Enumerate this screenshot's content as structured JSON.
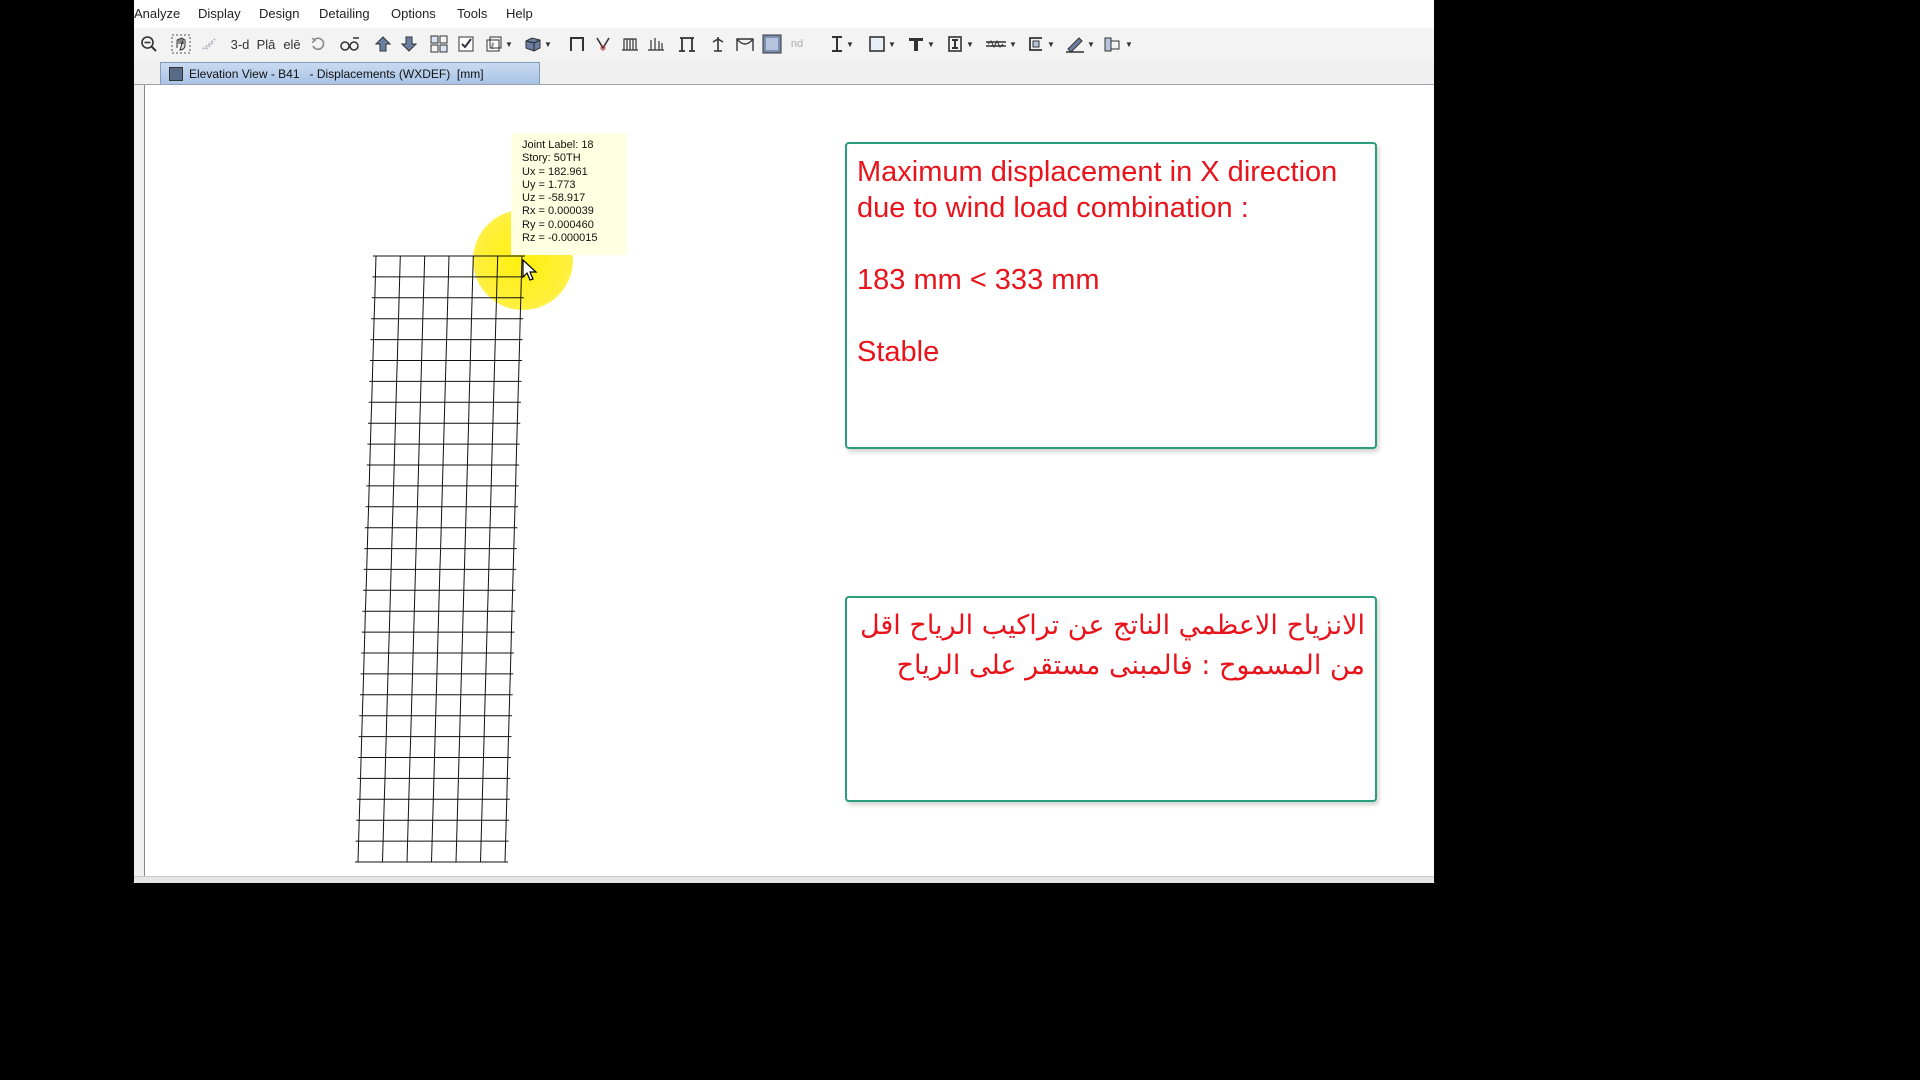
{
  "menubar": {
    "items": [
      "Analyze",
      "Display",
      "Design",
      "Detailing",
      "Options",
      "Tools",
      "Help"
    ]
  },
  "toolbar": {
    "buttons": [
      {
        "icon": "zoom-out-icon",
        "label": ""
      },
      {
        "icon": "pan-icon",
        "label": ""
      },
      {
        "icon": "rubber-band-icon",
        "label": ""
      },
      {
        "icon": "3d-view-icon",
        "label": "3-d"
      },
      {
        "icon": "plan-view-icon",
        "label": "Plā"
      },
      {
        "icon": "elevation-view-icon",
        "label": "elē"
      },
      {
        "icon": "rotate-icon",
        "label": ""
      },
      {
        "icon": "perspective-icon",
        "label": ""
      },
      {
        "icon": "move-up-icon",
        "label": ""
      },
      {
        "icon": "move-down-icon",
        "label": ""
      },
      {
        "icon": "object-shrink-icon",
        "label": ""
      },
      {
        "icon": "set-display-options-icon",
        "label": ""
      },
      {
        "icon": "select-icon",
        "label": ""
      },
      {
        "icon": "extrude-icon",
        "label": ""
      },
      {
        "icon": "frame-icon",
        "label": ""
      },
      {
        "icon": "deformed-shape-icon",
        "label": ""
      },
      {
        "icon": "forces-icon",
        "label": ""
      },
      {
        "icon": "reactions-icon",
        "label": ""
      },
      {
        "icon": "draw-frame-icon",
        "label": ""
      },
      {
        "icon": "joint-icon",
        "label": ""
      },
      {
        "icon": "moment-icon",
        "label": ""
      },
      {
        "icon": "area-icon",
        "label": ""
      },
      {
        "icon": "nd-icon",
        "label": "nd"
      },
      {
        "icon": "draw-beam-icon",
        "label": "I"
      },
      {
        "icon": "draw-area-icon",
        "label": ""
      },
      {
        "icon": "draw-column-icon",
        "label": ""
      },
      {
        "icon": "draw-brace-icon",
        "label": ""
      },
      {
        "icon": "draw-link-icon",
        "label": ""
      },
      {
        "icon": "draw-wall-icon",
        "label": ""
      },
      {
        "icon": "pen-icon",
        "label": ""
      },
      {
        "icon": "reshape-icon",
        "label": ""
      }
    ]
  },
  "tab": {
    "title": "Elevation View - B41   - Displacements (WXDEF)  [mm]"
  },
  "tooltip": {
    "lines": [
      "Joint Label: 18",
      "Story: 50TH",
      "Ux =  182.961",
      "Uy =  1.773",
      "Uz = -58.917",
      "Rx =  0.000039",
      "Ry =  0.000460",
      "Rz = -0.000015"
    ]
  },
  "notes": {
    "english": {
      "heading": "Maximum displacement in X direction due to wind load combination :",
      "comparison": "183 mm < 333 mm",
      "result": "Stable"
    },
    "arabic": {
      "text": "الانزياح الاعظمي الناتج عن تراكيب الرياح اقل من المسموح : فالمبنى مستقر على الرياح"
    }
  },
  "colors": {
    "note_text": "#e8131b",
    "note_border": "#2a9d7e",
    "highlight": "#fff200"
  }
}
